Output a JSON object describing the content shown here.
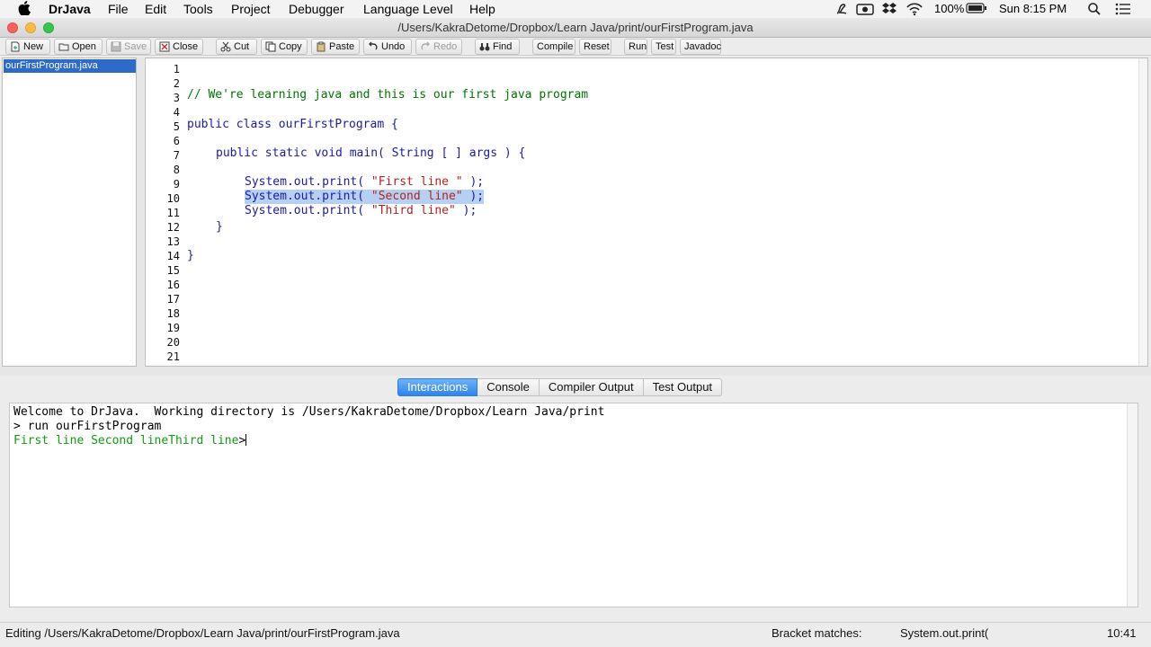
{
  "menubar": {
    "app_name": "DrJava",
    "items": [
      "File",
      "Edit",
      "Tools",
      "Project",
      "Debugger",
      "Language Level",
      "Help"
    ],
    "battery": "100%",
    "clock": "Sun 8:15 PM"
  },
  "window": {
    "title": "/Users/KakraDetome/Dropbox/Learn Java/print/ourFirstProgram.java"
  },
  "toolbar": {
    "new": "New",
    "open": "Open",
    "save": "Save",
    "close": "Close",
    "cut": "Cut",
    "copy": "Copy",
    "paste": "Paste",
    "undo": "Undo",
    "redo": "Redo",
    "find": "Find",
    "compile": "Compile",
    "reset": "Reset",
    "run": "Run",
    "test": "Test",
    "javadoc": "Javadoc"
  },
  "files": [
    "ourFirstProgram.java"
  ],
  "editor": {
    "line_numbers": [
      "1",
      "2",
      "3",
      "4",
      "5",
      "6",
      "7",
      "8",
      "9",
      "10",
      "11",
      "12",
      "13",
      "14",
      "15",
      "16",
      "17",
      "18",
      "19",
      "20",
      "21"
    ],
    "l3": "// We're learning java and this is our first java program",
    "l5_kw": "public class",
    "l5_rest": " ourFirstProgram {",
    "l7_kw": "public static void",
    "l7_rest": " main( String [ ] args ) {",
    "l9_a": "System.out.print( ",
    "l9_str": "\"First line \"",
    "l9_b": " );",
    "l10_a": "System.out.print( ",
    "l10_str": "\"Second line\"",
    "l10_b": " );",
    "l11_a": "System.out.print( ",
    "l11_str": "\"Third line\"",
    "l11_b": " );",
    "l12": "}",
    "l14": "}"
  },
  "tabs": [
    "Interactions",
    "Console",
    "Compiler Output",
    "Test Output"
  ],
  "interactions": {
    "welcome": "Welcome to DrJava.  Working directory is /Users/KakraDetome/Dropbox/Learn Java/print",
    "command": "> run ourFirstProgram",
    "output": "First line Second lineThird line",
    "prompt": ">"
  },
  "status": {
    "editing": "Editing /Users/KakraDetome/Dropbox/Learn Java/print/ourFirstProgram.java",
    "bracket_label": "Bracket matches:",
    "bracket_value": "System.out.print(",
    "position": "10:41"
  },
  "colors": {
    "selection": "#b5d0f3",
    "active_tab": "#2d84ef",
    "file_selected": "#2d6ac9",
    "comment": "#007400",
    "string": "#b5221c",
    "output_green": "#129a12"
  }
}
